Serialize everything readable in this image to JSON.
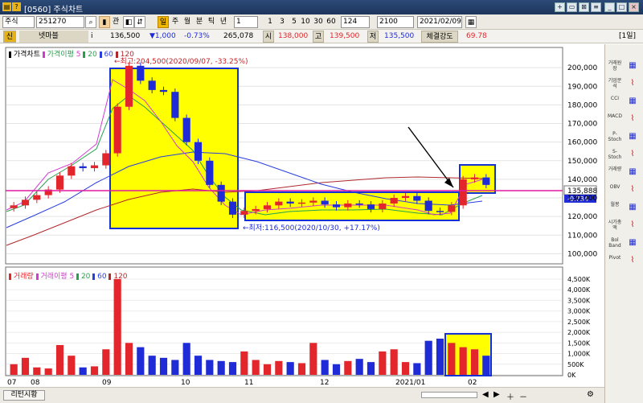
{
  "window": {
    "title": "[0560] 주식차트",
    "icons": [
      "app-icon",
      "help-icon"
    ],
    "buttons": [
      "new-window-icon",
      "print-icon",
      "link-icon",
      "menu-icon",
      "minimize-icon",
      "maximize-icon",
      "close-icon"
    ]
  },
  "toolbar": {
    "market": "주식",
    "code": "251270",
    "search_icon": "magnifier-icon",
    "sub_label": "관",
    "period_label_sel": "분",
    "periods": [
      "주",
      "월",
      "분",
      "틱",
      "년"
    ],
    "interval_value": "1",
    "interval_options": [
      "1",
      "3",
      "5",
      "10",
      "30",
      "60"
    ],
    "count": "124",
    "max_count": "2100",
    "date": "2021/02/09"
  },
  "info": {
    "badge": "신",
    "name": "넷마블",
    "i_label": "i",
    "price": "136,500",
    "change": "▼1,000",
    "change_pct": "-0.73%",
    "volume": "265,078",
    "low_label": "시",
    "open_value": "138,000",
    "high_label": "고",
    "high_value": "139,500",
    "low_label2": "저",
    "low_value": "135,500",
    "strength_label": "체결강도",
    "strength_value": "69.78",
    "period_tag": "[1일]"
  },
  "price_legend": {
    "title": "가격차트",
    "ma_label": "가격이평",
    "ma_periods": [
      "5",
      "20",
      "60",
      "120"
    ]
  },
  "volume_legend": {
    "title": "거래량",
    "ma_label": "거래이평",
    "ma_periods": [
      "5",
      "20",
      "60",
      "120"
    ]
  },
  "annotations": {
    "high": "최고:204,500(2020/09/07, -33.25%)",
    "low": "최저:116,500(2020/10/30, +17.17%)",
    "current_price": "135,888",
    "current_change": "-0.734"
  },
  "colors": {
    "up": "#e3262b",
    "down": "#1f2bd6",
    "ma5": "#d23ad0",
    "ma20": "#27a04d",
    "ma60": "#2a3ee0",
    "ma120": "#b0292e",
    "highlight": "#ffff00",
    "box_border": "#1432d3",
    "hline": "#e01aa0"
  },
  "chart_data": [
    {
      "type": "line",
      "title": "가격차트",
      "ylim": [
        95000,
        210000
      ],
      "y_ticks": [
        "200,000",
        "190,000",
        "180,000",
        "170,000",
        "160,000",
        "150,000",
        "140,000",
        "130,000",
        "120,000",
        "110,000",
        "100,000"
      ],
      "x_ticks": [
        "07",
        "08",
        "09",
        "10",
        "11",
        "12",
        "2021/01",
        "02"
      ],
      "series": [
        {
          "name": "종가",
          "values": [
            126000,
            129000,
            131500,
            134500,
            142000,
            147000,
            146000,
            147500,
            154000,
            179000,
            201000,
            193000,
            188000,
            187000,
            173000,
            160000,
            150000,
            137000,
            128000,
            121000,
            123000,
            124000,
            126000,
            128000,
            127000,
            127500,
            128500,
            126500,
            125000,
            127000,
            126500,
            124000,
            127000,
            130000,
            131000,
            128500,
            123000,
            122500,
            126000,
            140000,
            141000,
            137000
          ]
        }
      ]
    },
    {
      "type": "bar",
      "title": "거래량",
      "ylim": [
        0,
        4800000
      ],
      "y_ticks": [
        "4,500K",
        "4,000K",
        "3,500K",
        "3,000K",
        "2,500K",
        "2,000K",
        "1,500K",
        "1,000K",
        "500K",
        "0K"
      ],
      "x_ticks": [
        "07",
        "08",
        "09",
        "10",
        "11",
        "12",
        "2021/01",
        "02"
      ],
      "series": [
        {
          "name": "거래량",
          "values": [
            500000,
            800000,
            350000,
            300000,
            1400000,
            900000,
            350000,
            400000,
            1200000,
            4500000,
            1500000,
            1300000,
            900000,
            800000,
            700000,
            1500000,
            900000,
            700000,
            650000,
            600000,
            1100000,
            700000,
            500000,
            650000,
            600000,
            550000,
            1500000,
            700000,
            500000,
            650000,
            750000,
            600000,
            1100000,
            1200000,
            600000,
            550000,
            1600000,
            1700000,
            1500000,
            1300000,
            1200000,
            900000
          ]
        }
      ]
    }
  ],
  "right_tools": [
    "거래원장",
    "기업분석",
    "CCI",
    "MACD",
    "P-Stoch",
    "S-Stoch",
    "거래량",
    "OBV",
    "월봉",
    "시가총액",
    "Bol Band",
    "Pivot"
  ],
  "bottom": {
    "label": "리턴시황",
    "nav_icons": [
      "scroll-left-icon",
      "scroll-right-icon",
      "zoom-in-icon",
      "zoom-out-icon",
      "settings-icon"
    ]
  }
}
